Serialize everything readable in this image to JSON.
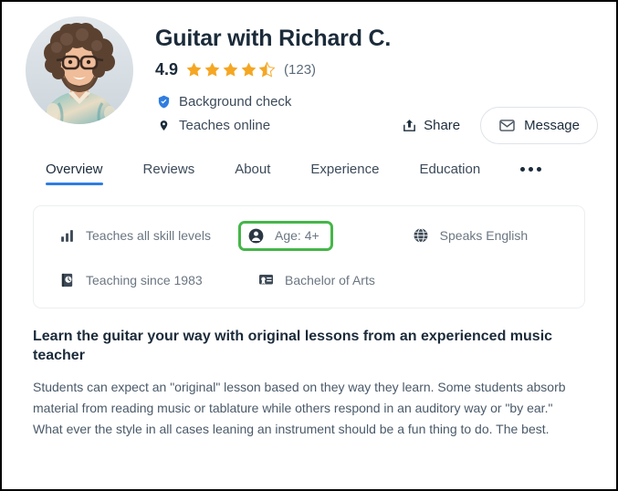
{
  "profile": {
    "name": "Guitar with Richard C.",
    "avatar_alt": "profile-photo-bearded-man-with-glasses",
    "rating": {
      "value": "4.9",
      "stars_full": 4,
      "stars_half": 1,
      "review_count": "(123)",
      "star_color": "#f5a623"
    },
    "meta": [
      {
        "icon": "shield-check-icon",
        "label": "Background check",
        "icon_color": "#2f7de1"
      },
      {
        "icon": "location-pin-icon",
        "label": "Teaches online",
        "icon_color": "#1b2b3a"
      }
    ]
  },
  "actions": {
    "share_label": "Share",
    "share_icon": "share-arrow-icon",
    "message_label": "Message",
    "message_icon": "envelope-icon"
  },
  "tabs": {
    "items": [
      {
        "label": "Overview",
        "active": true
      },
      {
        "label": "Reviews",
        "active": false
      },
      {
        "label": "About",
        "active": false
      },
      {
        "label": "Experience",
        "active": false
      },
      {
        "label": "Education",
        "active": false
      }
    ],
    "overflow_icon": "ellipsis-icon",
    "active_underline_color": "#2f7de1"
  },
  "info_card": {
    "row1": [
      {
        "icon": "bar-chart-icon",
        "label": "Teaches all skill levels",
        "highlighted": false
      },
      {
        "icon": "person-icon",
        "label": "Age: 4+",
        "highlighted": true
      },
      {
        "icon": "globe-icon",
        "label": "Speaks English",
        "highlighted": false
      }
    ],
    "row2": [
      {
        "icon": "clock-book-icon",
        "label": "Teaching since 1983",
        "highlighted": false
      },
      {
        "icon": "certificate-icon",
        "label": "Bachelor of Arts",
        "highlighted": false
      }
    ],
    "highlight_color": "#45b649"
  },
  "about": {
    "heading": "Learn the guitar your way with original lessons from an experienced music teacher",
    "body": "Students can expect an \"original\" lesson based on they way they learn. Some students absorb material from reading music or tablature while others respond in an auditory way or \"by ear.\" What ever the style in all cases leaning an instrument should be a fun thing to do. The best."
  }
}
